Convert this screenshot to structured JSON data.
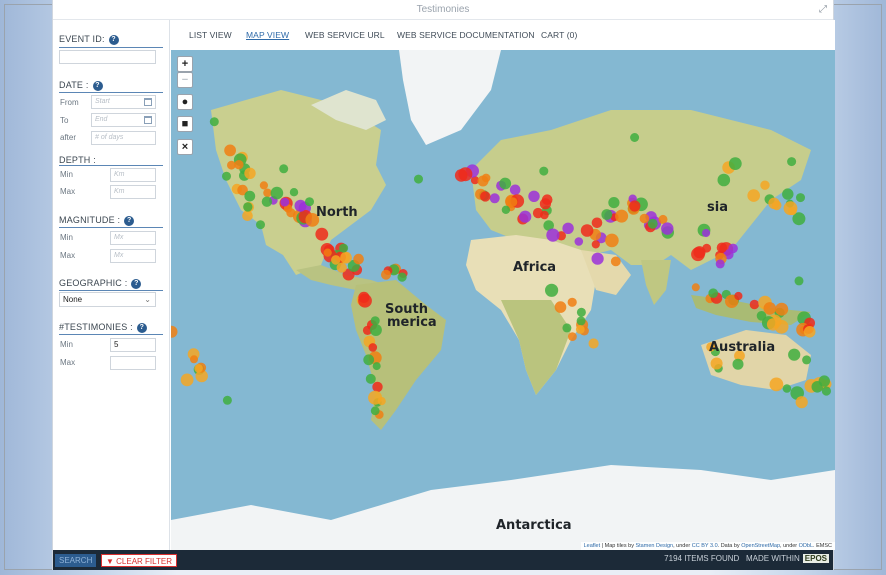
{
  "window": {
    "title": "Testimonies"
  },
  "sidebar": {
    "event_id": {
      "label": "EVENT ID:"
    },
    "date": {
      "label": "DATE :",
      "from_label": "From",
      "from_placeholder": "Start",
      "to_label": "To",
      "to_placeholder": "End",
      "after_label": "after",
      "after_placeholder": "# of days"
    },
    "depth": {
      "label": "DEPTH :",
      "min_label": "Min",
      "min_placeholder": "Km",
      "max_label": "Max",
      "max_placeholder": "Km"
    },
    "magnitude": {
      "label": "MAGNITUDE :",
      "min_label": "Min",
      "min_placeholder": "Mx",
      "max_label": "Max",
      "max_placeholder": "Mx"
    },
    "geographic": {
      "label": "GEOGRAPHIC :",
      "selected": "None"
    },
    "testimonies": {
      "label": "#TESTIMONIES :",
      "min_label": "Min",
      "min_value": "5",
      "max_label": "Max",
      "max_value": ""
    }
  },
  "tabs": [
    {
      "label": "LIST VIEW"
    },
    {
      "label": "MAP VIEW",
      "active": true
    },
    {
      "label": "WEB SERVICE URL"
    },
    {
      "label": "WEB SERVICE DOCUMENTATION"
    },
    {
      "label": "CART (0)"
    }
  ],
  "map": {
    "zoom_in": "+",
    "zoom_out": "−",
    "draw_circle": "●",
    "draw_rect": "■",
    "clear": "×",
    "labels": {
      "north_america": "North",
      "asia": "sia",
      "africa": "Africa",
      "south_america_1": "South",
      "south_america_2": "merica",
      "australia": "Australia",
      "antarctica": "Antarctica"
    },
    "attribution": {
      "leaflet": "Leaflet",
      "t1": " | Map tiles by ",
      "stamen": "Stamen Design",
      "t2": ", under ",
      "ccby": "CC BY 3.0",
      "t3": ". Data by ",
      "osm": "OpenStreetMap",
      "t4": ", under ",
      "odbl": "ODbL",
      "t5": ". EMSC"
    },
    "colors": {
      "low": "#3fae3f",
      "mid": "#f5a623",
      "orange": "#f07f13",
      "high": "#ee2a1b",
      "max": "#9b30d9",
      "water": "#84b8d2",
      "land": "#c9cf8f",
      "desert": "#e8dfb7",
      "ice": "#f2f4f5"
    }
  },
  "footer": {
    "search": "SEARCH",
    "clear": "CLEAR FILTER",
    "items_found": "7194 ITEMS FOUND",
    "made_within": "MADE WITHIN",
    "brand": "EPOS"
  }
}
